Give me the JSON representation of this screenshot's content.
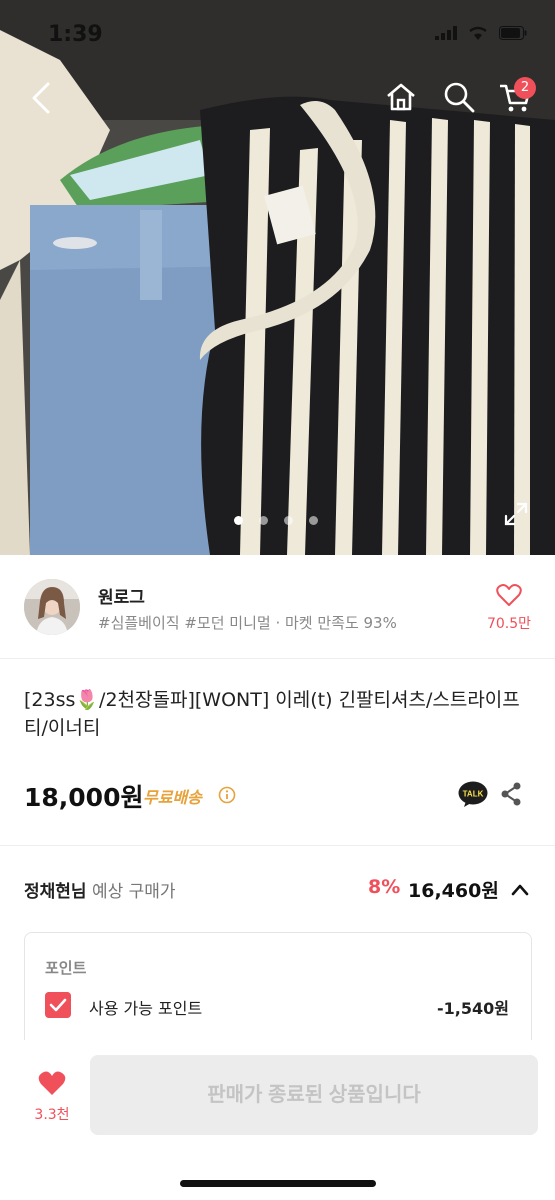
{
  "status_bar": {
    "time": "1:39"
  },
  "nav": {
    "cart_badge": "2"
  },
  "carousel": {
    "page_count": 4,
    "active_index": 0
  },
  "seller": {
    "name": "원로그",
    "tags": "#심플베이직 #모던 미니멀 · 마켓 만족도 93%",
    "likes": "70.5만"
  },
  "product": {
    "title": "[23ss🌷/2천장돌파][WONT] 이레(t) 긴팔티셔츠/스트라이프티/이너티",
    "price": "18,000원",
    "shipping": "무료배송"
  },
  "buyer_price": {
    "name": "정채현님",
    "label": "예상 구매가",
    "discount": "8%",
    "price": "16,460원"
  },
  "points": {
    "title": "포인트",
    "label": "사용 가능 포인트",
    "value": "-1,540원",
    "checked": true
  },
  "bottom": {
    "wish_count": "3.3천",
    "sold_out_label": "판매가 종료된 상품입니다"
  },
  "colors": {
    "accent": "#f0505a",
    "shipping": "#e7a23b"
  }
}
